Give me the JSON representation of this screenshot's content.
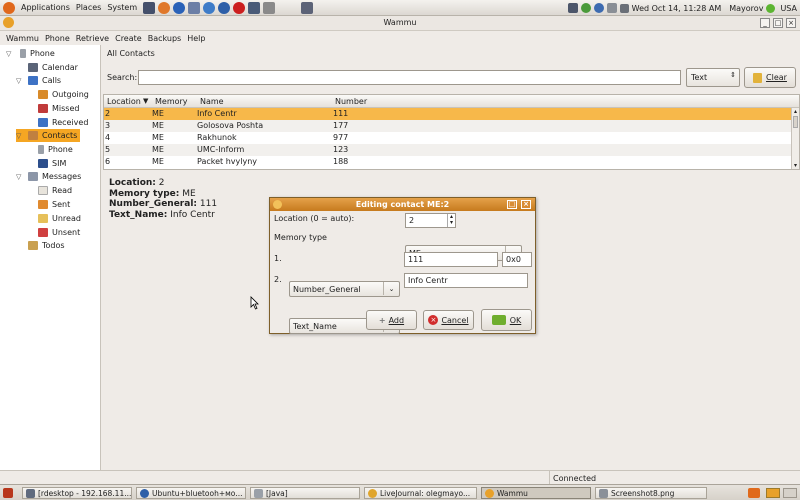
{
  "panel": {
    "menus": [
      "Applications",
      "Places",
      "System"
    ],
    "clock": "Wed Oct 14, 11:28 AM",
    "user": "Mayorov",
    "locale": "USA"
  },
  "window": {
    "title": "Wammu",
    "menu": [
      "Wammu",
      "Phone",
      "Retrieve",
      "Create",
      "Backups",
      "Help"
    ]
  },
  "sidebar": {
    "items": [
      {
        "label": "Phone"
      },
      {
        "label": "Calendar"
      },
      {
        "label": "Calls"
      },
      {
        "label": "Outgoing"
      },
      {
        "label": "Missed"
      },
      {
        "label": "Received"
      },
      {
        "label": "Contacts"
      },
      {
        "label": "Phone"
      },
      {
        "label": "SIM"
      },
      {
        "label": "Messages"
      },
      {
        "label": "Read"
      },
      {
        "label": "Sent"
      },
      {
        "label": "Unread"
      },
      {
        "label": "Unsent"
      },
      {
        "label": "Todos"
      }
    ]
  },
  "main": {
    "section_title": "All Contacts",
    "search_label": "Search:",
    "search_value": "",
    "search_type": "Text",
    "clear_label": "Clear",
    "columns": [
      "Location",
      "Memory",
      "Name",
      "Number"
    ],
    "rows": [
      {
        "location": "2",
        "memory": "ME",
        "name": "Info Centr",
        "number": "111"
      },
      {
        "location": "3",
        "memory": "ME",
        "name": "Golosova Poshta",
        "number": "177"
      },
      {
        "location": "4",
        "memory": "ME",
        "name": "Rakhunok",
        "number": "977"
      },
      {
        "location": "5",
        "memory": "ME",
        "name": "UMC-Inform",
        "number": "123"
      },
      {
        "location": "6",
        "memory": "ME",
        "name": "Packet hvylyny",
        "number": "188"
      }
    ],
    "details": {
      "location_label": "Location:",
      "location_value": "2",
      "memtype_label": "Memory type:",
      "memtype_value": "ME",
      "number_label": "Number_General:",
      "number_value": "111",
      "name_label": "Text_Name:",
      "name_value": "Info Centr"
    }
  },
  "dialog": {
    "title": "Editing contact ME:2",
    "location_label": "Location (0 = auto):",
    "location_value": "2",
    "memtype_label": "Memory type",
    "memtype_value": "ME",
    "fields": [
      {
        "index": "1.",
        "type": "Number_General",
        "value": "111",
        "extra": "0x0"
      },
      {
        "index": "2.",
        "type": "Text_Name",
        "value": "Info Centr"
      }
    ],
    "add_label": "Add",
    "cancel_label": "Cancel",
    "ok_label": "OK"
  },
  "statusbar": {
    "text": "Connected"
  },
  "taskbar": {
    "tasks": [
      {
        "label": "[rdesktop - 192.168.11..."
      },
      {
        "label": "Ubuntu+bluetooh+мо..."
      },
      {
        "label": "[Java]"
      },
      {
        "label": "LiveJournal: olegmayo..."
      },
      {
        "label": "Wammu"
      },
      {
        "label": "Screenshot8.png"
      }
    ]
  },
  "colors": {
    "selection": "#f5a623",
    "dialog_title": "#d08428",
    "row_selected": "#f7b84a"
  }
}
